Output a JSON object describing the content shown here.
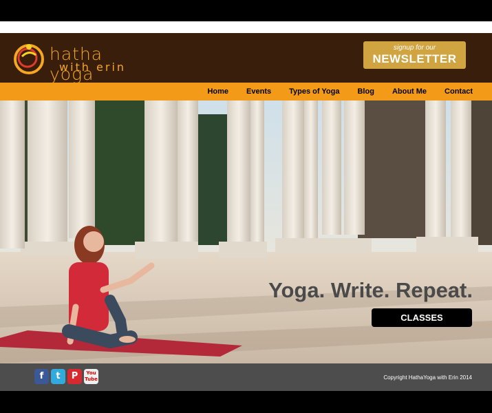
{
  "brand": {
    "name_line1": "hatha yoga",
    "name_line2": "with erin"
  },
  "newsletter": {
    "small": "signup for our",
    "big": "NEWSLETTER"
  },
  "nav": {
    "items": [
      "Home",
      "Events",
      "Types of Yoga",
      "Blog",
      "About Me",
      "Contact"
    ]
  },
  "hero": {
    "tagline": "Yoga. Write. Repeat.",
    "button": "CLASSES"
  },
  "footer": {
    "social": [
      "f",
      "t",
      "P",
      "You Tube"
    ],
    "social_icons": [
      "facebook-icon",
      "twitter-icon",
      "pinterest-icon",
      "youtube-icon"
    ],
    "copyright": "Copyright HathaYoga with Erin 2014"
  },
  "colors": {
    "header": "#3a1e0c",
    "nav": "#f39a18",
    "accent": "#cfa441",
    "footer": "#4d4d4d"
  }
}
